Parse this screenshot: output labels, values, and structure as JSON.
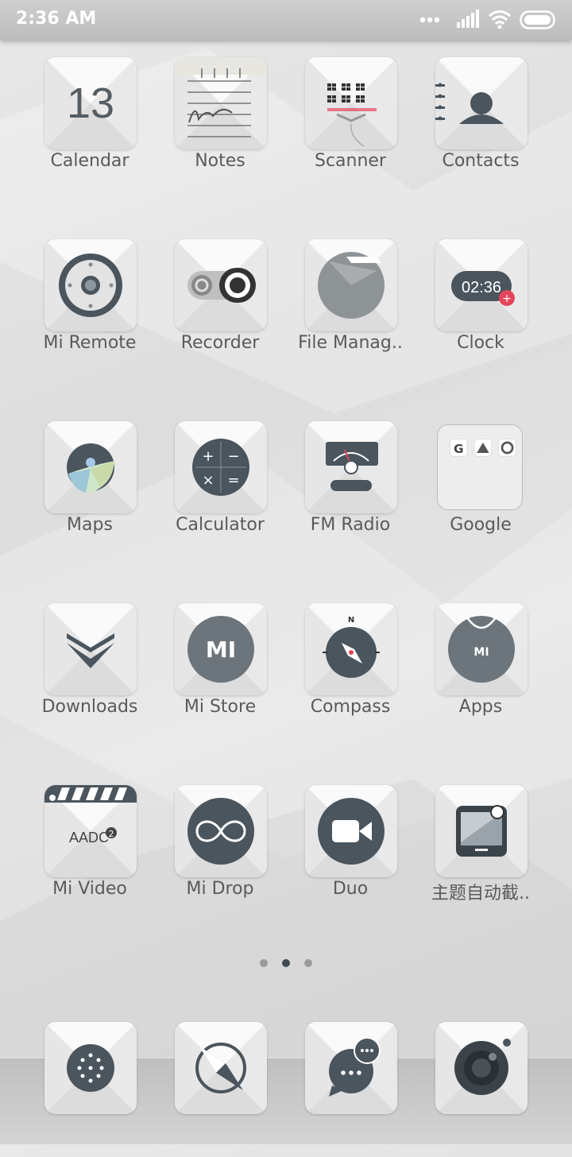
{
  "status_bar": {
    "time": "2:36 AM"
  },
  "apps": [
    {
      "name": "calendar",
      "label": "Calendar",
      "icon": "calendar-icon",
      "day": "13"
    },
    {
      "name": "notes",
      "label": "Notes",
      "icon": "notes-icon"
    },
    {
      "name": "scanner",
      "label": "Scanner",
      "icon": "qr-scanner-icon"
    },
    {
      "name": "contacts",
      "label": "Contacts",
      "icon": "contacts-icon"
    },
    {
      "name": "mi-remote",
      "label": "Mi Remote",
      "icon": "remote-icon"
    },
    {
      "name": "recorder",
      "label": "Recorder",
      "icon": "recorder-icon"
    },
    {
      "name": "file-manager",
      "label": "File Manag..",
      "icon": "folder-icon"
    },
    {
      "name": "clock",
      "label": "Clock",
      "icon": "clock-icon",
      "time": "02:36"
    },
    {
      "name": "maps",
      "label": "Maps",
      "icon": "maps-icon"
    },
    {
      "name": "calculator",
      "label": "Calculator",
      "icon": "calculator-icon"
    },
    {
      "name": "fm-radio",
      "label": "FM Radio",
      "icon": "radio-icon"
    },
    {
      "name": "google",
      "label": "Google",
      "icon": "folder-icon"
    },
    {
      "name": "downloads",
      "label": "Downloads",
      "icon": "download-icon"
    },
    {
      "name": "mi-store",
      "label": "Mi Store",
      "icon": "mi-store-icon",
      "logo": "MI"
    },
    {
      "name": "compass",
      "label": "Compass",
      "icon": "compass-icon",
      "north": "N"
    },
    {
      "name": "apps",
      "label": "Apps",
      "icon": "shopping-bag-icon",
      "logo": "MI"
    },
    {
      "name": "mi-video",
      "label": "Mi Video",
      "icon": "video-clapper-icon",
      "text": "AADC",
      "badge": "2"
    },
    {
      "name": "mi-drop",
      "label": "Mi Drop",
      "icon": "infinity-icon"
    },
    {
      "name": "duo",
      "label": "Duo",
      "icon": "video-camera-icon"
    },
    {
      "name": "theme-screenshot",
      "label": "主题自动截..",
      "icon": "screenshot-icon"
    }
  ],
  "google_folder_letters": [
    "G"
  ],
  "pager": {
    "pages": 3,
    "current": 2
  },
  "dock": [
    {
      "name": "phone",
      "icon": "dialpad-icon"
    },
    {
      "name": "browser",
      "icon": "browser-compass-icon"
    },
    {
      "name": "messaging",
      "icon": "chat-bubble-icon"
    },
    {
      "name": "camera",
      "icon": "camera-icon"
    }
  ],
  "colors": {
    "icon_dark": "#4a555e",
    "tile": "#f2f2f2",
    "label": "#5a5a5a",
    "accent_red": "#e5455b"
  }
}
